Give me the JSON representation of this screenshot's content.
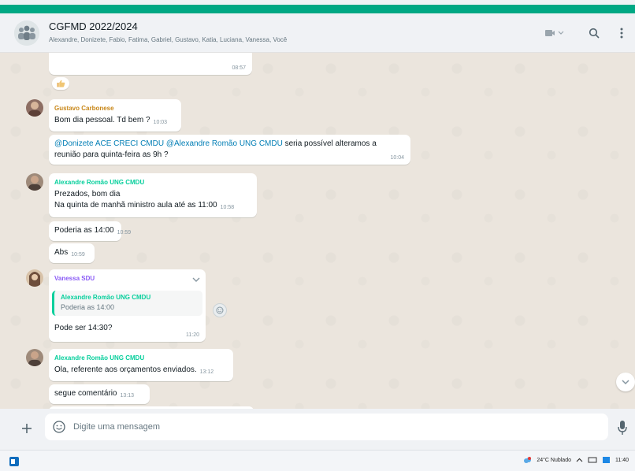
{
  "chat_header": {
    "title": "CGFMD 2022/2024",
    "members": "Alexandre, Donizete, Fabio, Fatima, Gabriel, Gustavo, Katia, Luciana, Vanessa, Você"
  },
  "messages": {
    "partial_top": {
      "time": "08:57",
      "reaction": "thumbs-up-icon"
    },
    "m1": {
      "sender": "Gustavo Carbonese",
      "sender_color": "#c88719",
      "text": "Bom dia pessoal. Td bem ?",
      "time": "10:03"
    },
    "m2": {
      "mention1": "@Donizete ACE CRECI CMDU",
      "mention2": "@Alexandre Romão UNG CMDU",
      "text_a": " seria possível alteramos a",
      "text_b": "reunião para quinta-feira as 9h ?",
      "time": "10:04"
    },
    "m3": {
      "sender": "Alexandre Romão UNG CMDU",
      "sender_color": "#06cf9c",
      "line1": "Prezados, bom dia",
      "line2": "Na quinta de manhã ministro aula até as 11:00",
      "time": "10:58"
    },
    "m4": {
      "text": "Poderia as 14:00",
      "time": "10:59"
    },
    "m5": {
      "text": "Abs",
      "time": "10:59"
    },
    "m6": {
      "sender": "Vanessa SDU",
      "sender_color": "#8b5cf6",
      "quote_author": "Alexandre Romão UNG CMDU",
      "quote_text": "Poderia as 14:00",
      "text": "Pode ser 14:30?",
      "time": "11:20"
    },
    "m7": {
      "sender": "Alexandre Romão UNG CMDU",
      "sender_color": "#06cf9c",
      "text": "Ola, referente aos orçamentos enviados.",
      "time": "13:12"
    },
    "m8": {
      "text": "segue comentário",
      "time": "13:13"
    }
  },
  "composer": {
    "placeholder": "Digite uma mensagem"
  },
  "taskbar": {
    "weather": "24°C  Nublado",
    "clock": "11:40"
  },
  "colors": {
    "accent": "#00a884",
    "mention": "#027eb5"
  }
}
